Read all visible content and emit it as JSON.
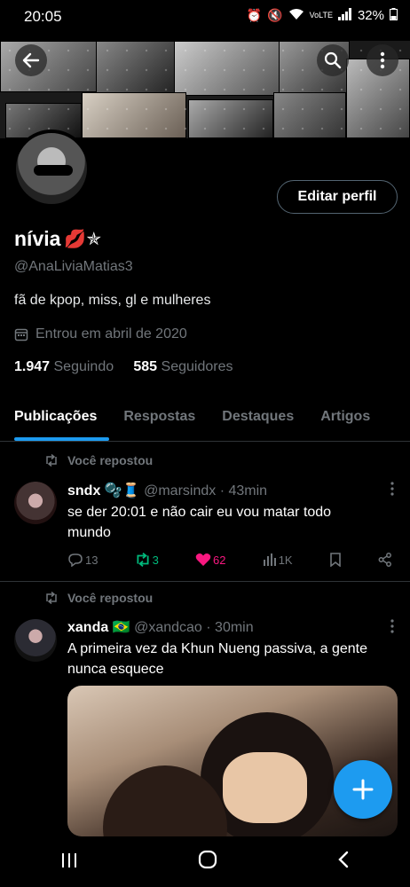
{
  "status_bar": {
    "time": "20:05",
    "network": "VoLTE",
    "battery": "32%"
  },
  "profile": {
    "name": "nívia",
    "name_emojis": "💋✯",
    "handle": "@AnaLiviaMatias3",
    "bio": "fã de kpop, miss, gl e mulheres",
    "joined": "Entrou em abril de 2020",
    "following_count": "1.947",
    "following_label": "Seguindo",
    "followers_count": "585",
    "followers_label": "Seguidores",
    "edit_button": "Editar perfil"
  },
  "tabs": [
    "Publicações",
    "Respostas",
    "Destaques",
    "Artigos"
  ],
  "posts": [
    {
      "repost_label": "Você repostou",
      "author": "sndx",
      "author_emojis": "🫧🧵",
      "handle": "@marsindx",
      "time": "· 43min",
      "text": "se der 20:01 e não cair eu vou matar todo mundo",
      "replies": "13",
      "reposts": "3",
      "likes": "62",
      "views": "1K"
    },
    {
      "repost_label": "Você repostou",
      "author": "xanda",
      "author_emojis": "🇧🇷",
      "handle": "@xandcao",
      "time": "· 30min",
      "text": "A primeira vez da Khun Nueng passiva, a gente nunca esquece"
    }
  ],
  "icons": {
    "back": "back-arrow-icon",
    "search": "search-icon",
    "more": "more-vertical-icon",
    "calendar": "calendar-icon",
    "compose": "plus-icon"
  },
  "colors": {
    "accent": "#1d9bf0",
    "repost": "#00ba7c",
    "like": "#f91880",
    "muted": "#71767b"
  }
}
